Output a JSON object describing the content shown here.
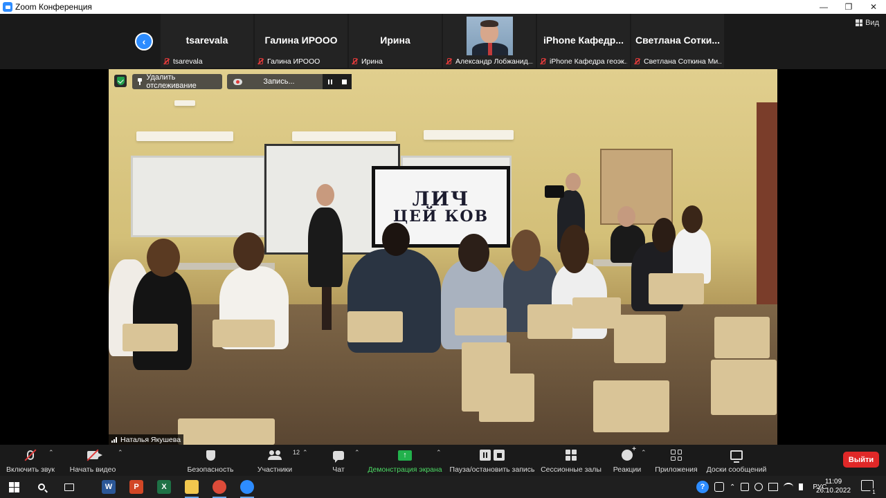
{
  "window": {
    "title": "Zoom Конференция",
    "minimize": "—",
    "maximize": "❐",
    "close": "✕"
  },
  "view_button": {
    "label": "Вид"
  },
  "thumbnails": [
    {
      "name": "tsarevala",
      "label": "tsarevala",
      "type": "name"
    },
    {
      "name": "Галина ИРООО",
      "label": "Галина ИРООО",
      "type": "name"
    },
    {
      "name": "Ирина",
      "label": "Ирина",
      "type": "name"
    },
    {
      "name": "",
      "label": "Александр Лобжанид...",
      "type": "video"
    },
    {
      "name": "iPhone  Кафедр...",
      "label": "iPhone Кафедра геоэк...",
      "type": "name"
    },
    {
      "name": "Светлана  Сотки...",
      "label": "Светлана Соткина Ми...",
      "type": "name"
    }
  ],
  "overlay": {
    "unpin_label": "Удалить отслеживание",
    "recording_label": "Запись..."
  },
  "speaker": {
    "name": "Наталья Якушева"
  },
  "screen_text": {
    "line1": "ЛИЧ",
    "line2": "ЦЕЙ КОВ"
  },
  "toolbar": {
    "mute_label": "Включить звук",
    "video_label": "Начать видео",
    "security_label": "Безопасность",
    "participants_label": "Участники",
    "participants_count": "12",
    "chat_label": "Чат",
    "share_label": "Демонстрация экрана",
    "pause_record_label": "Пауза/остановить запись",
    "rooms_label": "Сессионные залы",
    "reactions_label": "Реакции",
    "apps_label": "Приложения",
    "whiteboards_label": "Доски сообщений",
    "leave_label": "Выйти"
  },
  "taskbar": {
    "apps": [
      {
        "name": "word-icon",
        "letter": "W",
        "color": "#2b5797"
      },
      {
        "name": "powerpoint-icon",
        "letter": "P",
        "color": "#d24726"
      },
      {
        "name": "excel-icon",
        "letter": "X",
        "color": "#1e7145"
      },
      {
        "name": "explorer-icon",
        "letter": "",
        "color": "#f2c74e"
      },
      {
        "name": "chrome-icon",
        "letter": "",
        "color": "#dd4b39"
      },
      {
        "name": "zoom-icon",
        "letter": "",
        "color": "#2d8cff"
      }
    ],
    "language": "РУС",
    "time": "11:09",
    "date": "26.10.2022",
    "notifications_count": "1"
  },
  "colors": {
    "accent": "#2d8cff",
    "share_green": "#22b14c",
    "leave_red": "#e02828",
    "muted_red": "#e03a3a"
  }
}
